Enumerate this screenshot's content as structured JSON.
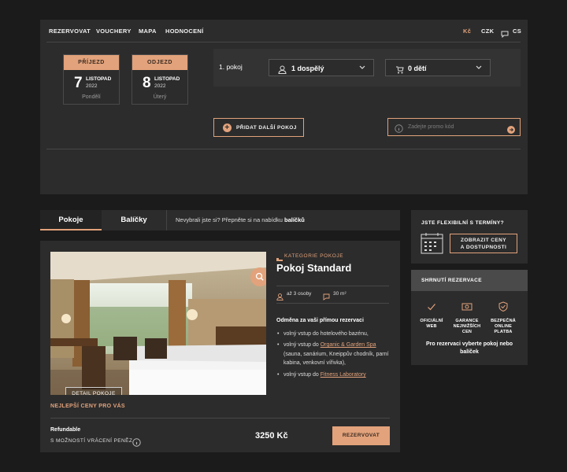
{
  "nav": {
    "items": [
      "REZERVOVAT",
      "VOUCHERY",
      "MAPA",
      "HODNOCENÍ"
    ],
    "currency_symbol": "Kč",
    "currency_code": "CZK",
    "language": "CS"
  },
  "dates": {
    "arrival": {
      "header": "PŘÍJEZD",
      "day": "7",
      "month": "LISTOPAD",
      "year": "2022",
      "weekday": "Pondělí"
    },
    "departure": {
      "header": "ODJEZD",
      "day": "8",
      "month": "LISTOPAD",
      "year": "2022",
      "weekday": "Úterý"
    }
  },
  "room_selector": {
    "room_label": "1. pokoj",
    "adults": "1 dospělý",
    "children": "0 dětí"
  },
  "actions": {
    "add_room": "PŘIDAT DALŠÍ POKOJ",
    "promo_placeholder": "Zadejte promo kód"
  },
  "tabs": {
    "rooms": "Pokoje",
    "packages": "Balíčky",
    "note_prefix": "Nevybrali jste si? Přepněte si na nabídku ",
    "note_bold": "balíčků"
  },
  "room": {
    "category": "KATEGORIE POKOJE",
    "title": "Pokoj Standard",
    "capacity": "až 3 osoby",
    "area": "30 m²",
    "detail_button": "DETAIL POKOJE",
    "benefits_title": "Odměna za vaši přímou rezervaci",
    "benefit_1": "volný vstup do hotelového bazénu,",
    "benefit_2_prefix": "volný vstup do ",
    "benefit_2_link": "Organic & Garden Spa",
    "benefit_2_suffix": " (sauna, sanárium, Kneippův chodník, parní kabina, venkovní vířivka),",
    "benefit_3_prefix": "volný vstup do ",
    "benefit_3_link": "Fitness Laboratory",
    "best_price": "NEJLEPŠÍ CENY PRO VÁS",
    "rate_name": "Refundable",
    "rate_note": "S MOŽNOSTÍ VRÁCENÍ PENĚZ",
    "price": "3250 Kč",
    "book_button": "REZERVOVAT"
  },
  "flexible": {
    "title": "JSTE FLEXIBILNÍ S TERMÍNY?",
    "button": "ZOBRAZIT CENY A DOSTUPNOSTI"
  },
  "summary": {
    "title": "SHRNUTÍ REZERVACE",
    "feature_1": "OFICIÁLNÍ WEB",
    "feature_2": "GARANCE NEJNIŽŠÍCH CEN",
    "feature_3": "BEZPEČNÁ ONLINE PLATBA",
    "note": "Pro rezervaci vyberte pokoj nebo balíček"
  },
  "colors": {
    "accent": "#e2a27b",
    "panel": "#2c2c2c",
    "background": "#1b1b1b"
  }
}
